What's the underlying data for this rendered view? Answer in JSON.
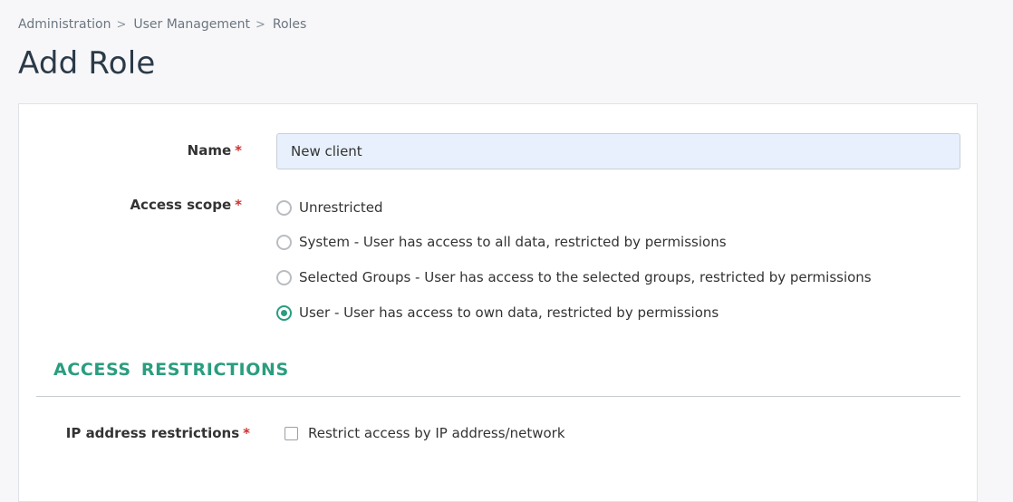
{
  "breadcrumb": {
    "items": [
      "Administration",
      "User Management",
      "Roles"
    ],
    "separator": ">"
  },
  "page": {
    "title": "Add Role"
  },
  "form": {
    "required_marker": "*",
    "name": {
      "label": "Name",
      "value": "New client"
    },
    "access_scope": {
      "label": "Access scope",
      "options": [
        {
          "label": "Unrestricted",
          "checked": false
        },
        {
          "label": "System - User has access to all data, restricted by permissions",
          "checked": false
        },
        {
          "label": "Selected Groups - User has access to the selected groups, restricted by permissions",
          "checked": false
        },
        {
          "label": "User - User has access to own data, restricted by permissions",
          "checked": true
        }
      ]
    },
    "access_restrictions": {
      "title": "ACCESS RESTRICTIONS",
      "ip_restrictions": {
        "label": "IP address restrictions",
        "checkbox_label": "Restrict access by IP address/network",
        "checked": false
      }
    }
  },
  "colors": {
    "accent": "#2a9d7f",
    "required": "#d0312d",
    "input_bg": "#e8f0fe"
  }
}
